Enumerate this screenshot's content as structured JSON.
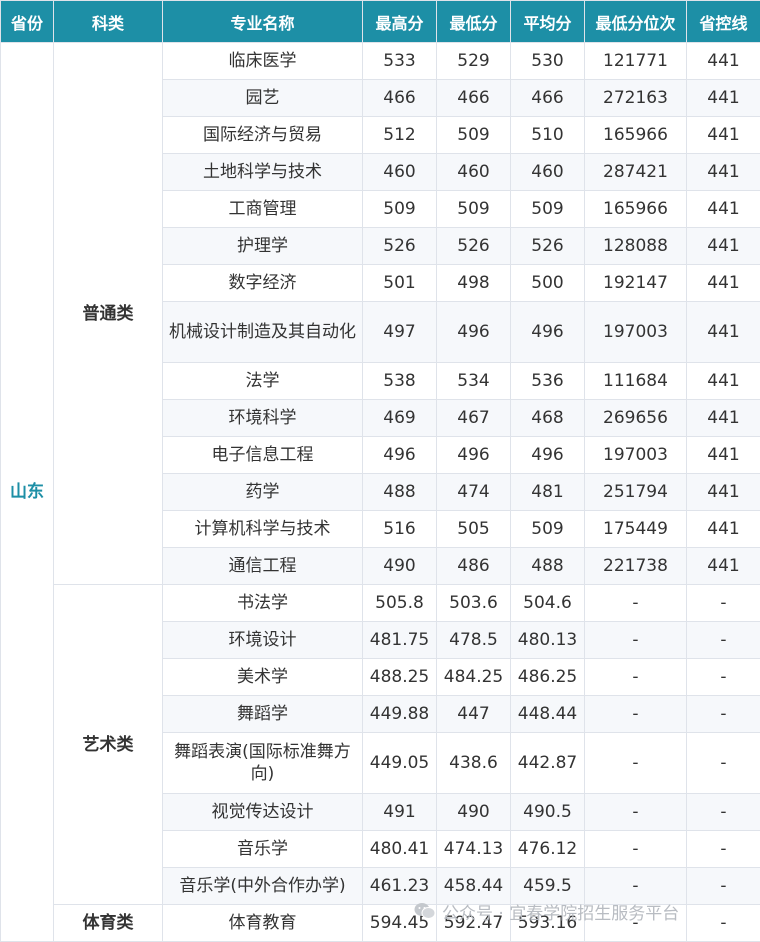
{
  "headers": [
    "省份",
    "科类",
    "专业名称",
    "最高分",
    "最低分",
    "平均分",
    "最低分位次",
    "省控线"
  ],
  "province": "山东",
  "groups": [
    {
      "category": "普通类",
      "rows": [
        {
          "major": "临床医学",
          "max": "533",
          "min": "529",
          "avg": "530",
          "rank": "121771",
          "line": "441"
        },
        {
          "major": "园艺",
          "max": "466",
          "min": "466",
          "avg": "466",
          "rank": "272163",
          "line": "441"
        },
        {
          "major": "国际经济与贸易",
          "max": "512",
          "min": "509",
          "avg": "510",
          "rank": "165966",
          "line": "441"
        },
        {
          "major": "土地科学与技术",
          "max": "460",
          "min": "460",
          "avg": "460",
          "rank": "287421",
          "line": "441"
        },
        {
          "major": "工商管理",
          "max": "509",
          "min": "509",
          "avg": "509",
          "rank": "165966",
          "line": "441"
        },
        {
          "major": "护理学",
          "max": "526",
          "min": "526",
          "avg": "526",
          "rank": "128088",
          "line": "441"
        },
        {
          "major": "数字经济",
          "max": "501",
          "min": "498",
          "avg": "500",
          "rank": "192147",
          "line": "441"
        },
        {
          "major": "机械设计制造及其自动化",
          "max": "497",
          "min": "496",
          "avg": "496",
          "rank": "197003",
          "line": "441"
        },
        {
          "major": "法学",
          "max": "538",
          "min": "534",
          "avg": "536",
          "rank": "111684",
          "line": "441"
        },
        {
          "major": "环境科学",
          "max": "469",
          "min": "467",
          "avg": "468",
          "rank": "269656",
          "line": "441"
        },
        {
          "major": "电子信息工程",
          "max": "496",
          "min": "496",
          "avg": "496",
          "rank": "197003",
          "line": "441"
        },
        {
          "major": "药学",
          "max": "488",
          "min": "474",
          "avg": "481",
          "rank": "251794",
          "line": "441"
        },
        {
          "major": "计算机科学与技术",
          "max": "516",
          "min": "505",
          "avg": "509",
          "rank": "175449",
          "line": "441"
        },
        {
          "major": "通信工程",
          "max": "490",
          "min": "486",
          "avg": "488",
          "rank": "221738",
          "line": "441"
        }
      ]
    },
    {
      "category": "艺术类",
      "rows": [
        {
          "major": "书法学",
          "max": "505.8",
          "min": "503.6",
          "avg": "504.6",
          "rank": "-",
          "line": "-"
        },
        {
          "major": "环境设计",
          "max": "481.75",
          "min": "478.5",
          "avg": "480.13",
          "rank": "-",
          "line": "-"
        },
        {
          "major": "美术学",
          "max": "488.25",
          "min": "484.25",
          "avg": "486.25",
          "rank": "-",
          "line": "-"
        },
        {
          "major": "舞蹈学",
          "max": "449.88",
          "min": "447",
          "avg": "448.44",
          "rank": "-",
          "line": "-"
        },
        {
          "major": "舞蹈表演(国际标准舞方向)",
          "max": "449.05",
          "min": "438.6",
          "avg": "442.87",
          "rank": "-",
          "line": "-"
        },
        {
          "major": "视觉传达设计",
          "max": "491",
          "min": "490",
          "avg": "490.5",
          "rank": "-",
          "line": "-"
        },
        {
          "major": "音乐学",
          "max": "480.41",
          "min": "474.13",
          "avg": "476.12",
          "rank": "-",
          "line": "-"
        },
        {
          "major": "音乐学(中外合作办学)",
          "max": "461.23",
          "min": "458.44",
          "avg": "459.5",
          "rank": "-",
          "line": "-"
        }
      ]
    },
    {
      "category": "体育类",
      "rows": [
        {
          "major": "体育教育",
          "max": "594.45",
          "min": "592.47",
          "avg": "593.16",
          "rank": "-",
          "line": "-"
        }
      ]
    }
  ],
  "watermark": {
    "text": "公众号 · 宜春学院招生服务平台",
    "icon": "wechat-icon"
  },
  "colors": {
    "header_bg": "#1d8fa6",
    "header_text": "#ffffff",
    "province_text": "#1d8fa6",
    "border": "#dfe3ea",
    "alt_row": "#f6f8fb"
  }
}
